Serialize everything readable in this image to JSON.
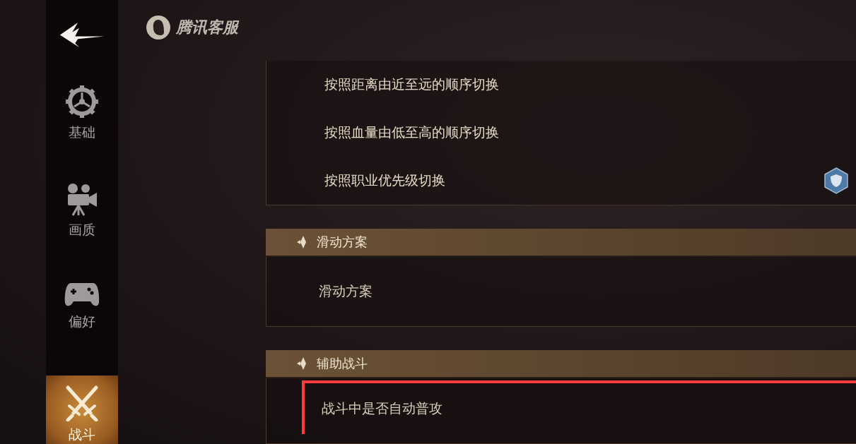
{
  "brand": {
    "name": "腾讯客服"
  },
  "sidebar": {
    "items": [
      {
        "label": "基础",
        "kind": "gear",
        "selected": false
      },
      {
        "label": "画质",
        "kind": "camera",
        "selected": false
      },
      {
        "label": "偏好",
        "kind": "gamepad",
        "selected": false
      },
      {
        "label": "战斗",
        "kind": "swords",
        "selected": true
      }
    ]
  },
  "target_options": [
    {
      "label": "按照距离由近至远的顺序切换",
      "selected": false
    },
    {
      "label": "按照血量由低至高的顺序切换",
      "selected": false
    },
    {
      "label": "按照职业优先级切换",
      "selected": true
    }
  ],
  "sections": [
    {
      "title": "滑动方案",
      "rows": [
        {
          "label": "滑动方案",
          "highlighted": false
        }
      ]
    },
    {
      "title": "辅助战斗",
      "rows": [
        {
          "label": "战斗中是否自动普攻",
          "highlighted": true
        }
      ]
    }
  ]
}
